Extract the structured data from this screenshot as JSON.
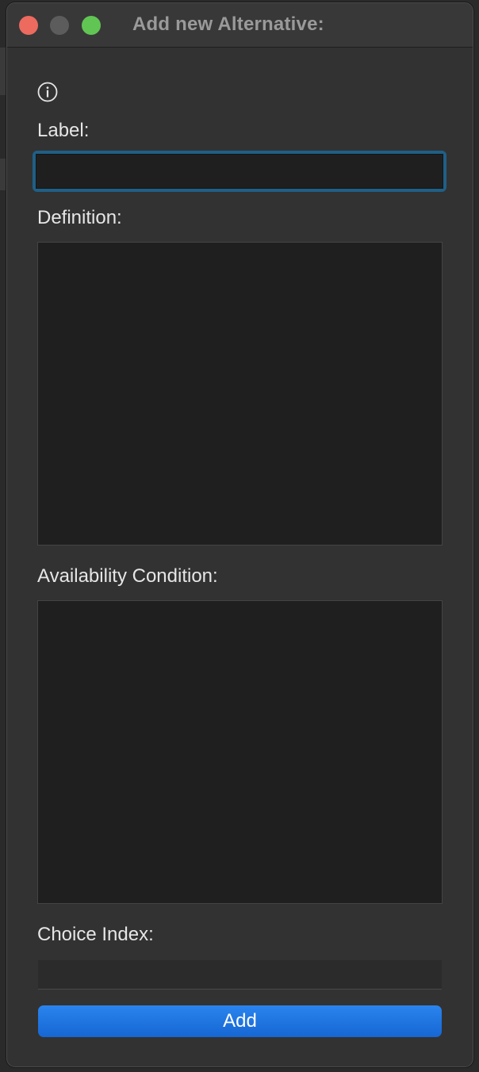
{
  "window": {
    "title": "Add new Alternative:",
    "traffic_lights": {
      "close_color": "#ec6a5e",
      "minimize_color": "#5c5c5c",
      "zoom_color": "#61c554"
    }
  },
  "form": {
    "info_icon": "info-circle-icon",
    "label": {
      "text": "Label:",
      "value": ""
    },
    "definition": {
      "text": "Definition:",
      "value": ""
    },
    "availability_condition": {
      "text": "Availability Condition:",
      "value": ""
    },
    "choice_index": {
      "text": "Choice Index:",
      "value": ""
    },
    "add_button_label": "Add"
  },
  "colors": {
    "accent": "#1a72e4",
    "focus_ring": "#1f5f86",
    "window_bg": "#323232",
    "field_bg": "#1f1f1f"
  }
}
